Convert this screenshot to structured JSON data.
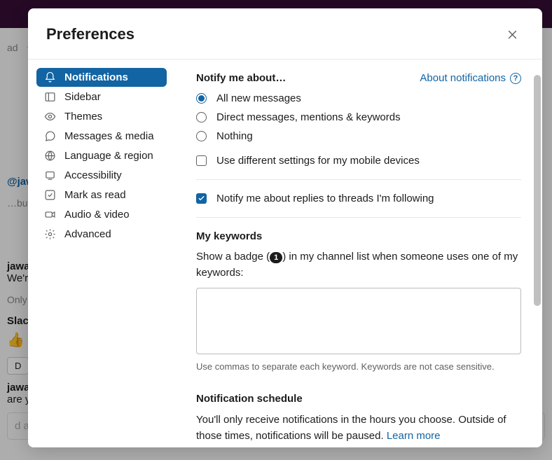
{
  "background": {
    "mention": "@jawad",
    "ellipsis": "…but",
    "jawad1": "jawad",
    "line1": "We're",
    "only": "Only v",
    "slack": "Slack",
    "jawad2": "jawad",
    "line2": "are yo",
    "compose": "d a me"
  },
  "modal": {
    "title": "Preferences",
    "sidebar": {
      "items": [
        {
          "label": "Notifications",
          "icon": "bell-icon"
        },
        {
          "label": "Sidebar",
          "icon": "sidebar-icon"
        },
        {
          "label": "Themes",
          "icon": "eye-icon"
        },
        {
          "label": "Messages & media",
          "icon": "chat-icon"
        },
        {
          "label": "Language & region",
          "icon": "globe-icon"
        },
        {
          "label": "Accessibility",
          "icon": "accessibility-icon"
        },
        {
          "label": "Mark as read",
          "icon": "check-icon"
        },
        {
          "label": "Audio & video",
          "icon": "camera-icon"
        },
        {
          "label": "Advanced",
          "icon": "gear-icon"
        }
      ]
    },
    "notify": {
      "heading": "Notify me about…",
      "about_link": "About notifications",
      "options": {
        "all": "All new messages",
        "direct": "Direct messages, mentions & keywords",
        "nothing": "Nothing"
      },
      "mobile": "Use different settings for my mobile devices",
      "threads": "Notify me about replies to threads I'm following"
    },
    "keywords": {
      "heading": "My keywords",
      "desc_pre": "Show a badge (",
      "badge": "1",
      "desc_post": ") in my channel list when someone uses one of my keywords:",
      "hint": "Use commas to separate each keyword. Keywords are not case sensitive."
    },
    "schedule": {
      "heading": "Notification schedule",
      "desc": "You'll only receive notifications in the hours you choose. Outside of those times, notifications will be paused. ",
      "learn": "Learn more"
    }
  }
}
